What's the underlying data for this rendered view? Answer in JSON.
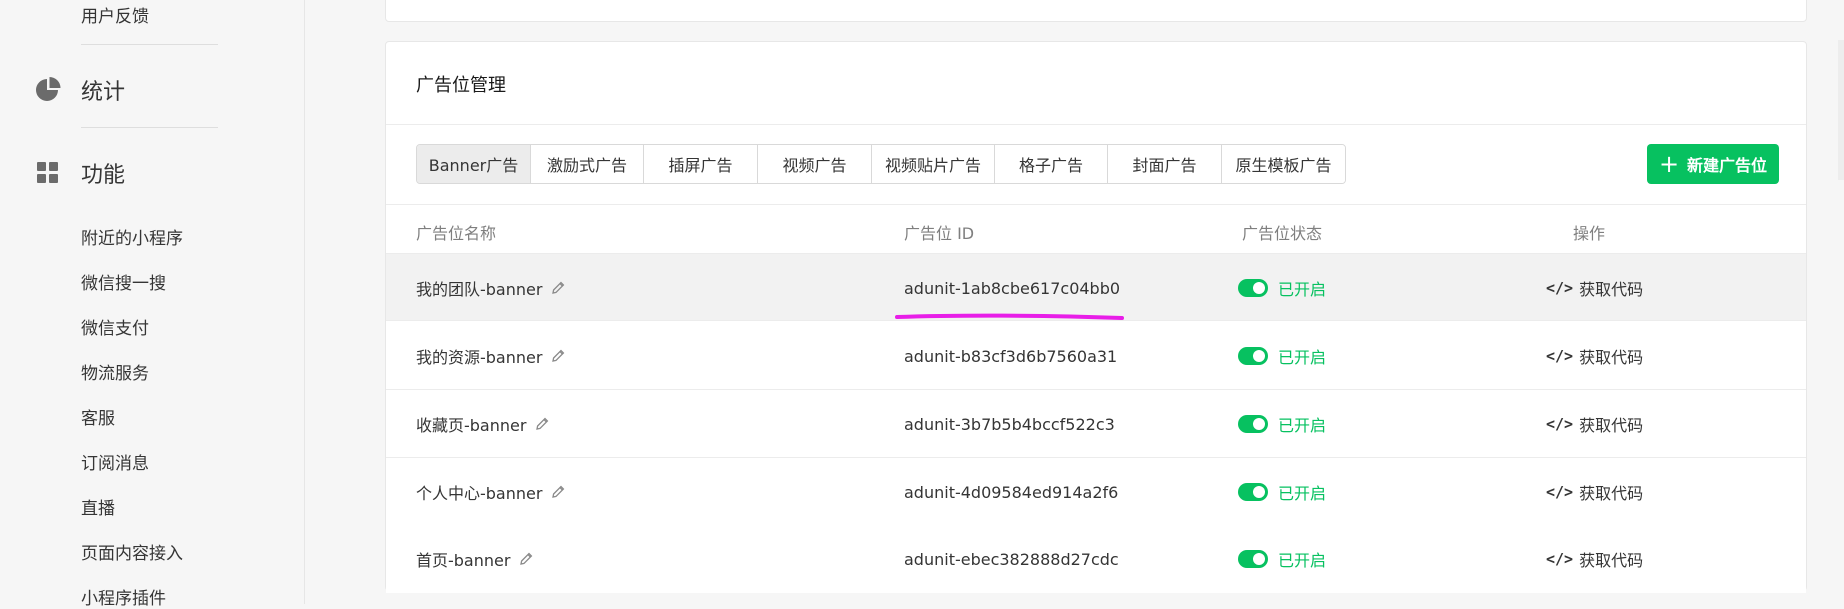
{
  "sidebar": {
    "top_item": "用户反馈",
    "groups": [
      {
        "label": "统计",
        "icon": "pie-chart-icon"
      },
      {
        "label": "功能",
        "icon": "grid-icon"
      }
    ],
    "features": [
      "附近的小程序",
      "微信搜一搜",
      "微信支付",
      "物流服务",
      "客服",
      "订阅消息",
      "直播",
      "页面内容接入",
      "小程序插件"
    ]
  },
  "card": {
    "title": "广告位管理",
    "tabs": [
      "Banner广告",
      "激励式广告",
      "插屏广告",
      "视频广告",
      "视频贴片广告",
      "格子广告",
      "封面广告",
      "原生模板广告"
    ],
    "active_tab": "Banner广告",
    "new_button": "新建广告位",
    "columns": [
      "广告位名称",
      "广告位 ID",
      "广告位状态",
      "操作"
    ],
    "rows": [
      {
        "name": "我的团队-banner",
        "id": "adunit-1ab8cbe617c04bb0",
        "status": "已开启",
        "action": "获取代码"
      },
      {
        "name": "我的资源-banner",
        "id": "adunit-b83cf3d6b7560a31",
        "status": "已开启",
        "action": "获取代码"
      },
      {
        "name": "收藏页-banner",
        "id": "adunit-3b7b5b4bccf522c3",
        "status": "已开启",
        "action": "获取代码"
      },
      {
        "name": "个人中心-banner",
        "id": "adunit-4d09584ed914a2f6",
        "status": "已开启",
        "action": "获取代码"
      },
      {
        "name": "首页-banner",
        "id": "adunit-ebec382888d27cdc",
        "status": "已开启",
        "action": "获取代码"
      }
    ]
  },
  "colors": {
    "accent": "#07c160",
    "annotation": "#e81ee8"
  }
}
